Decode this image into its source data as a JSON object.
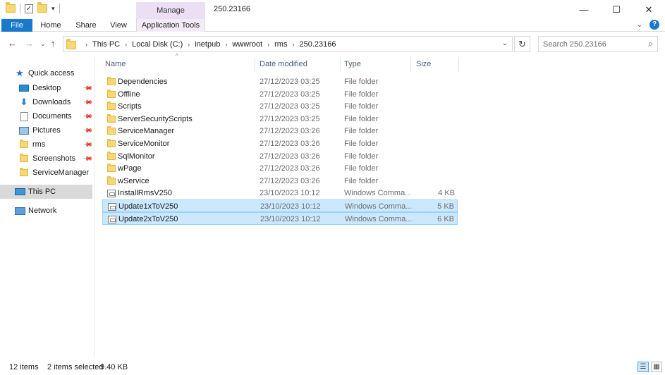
{
  "window": {
    "title": "250.23166",
    "minimize_glyph": "—",
    "maximize_glyph": "☐",
    "close_glyph": "✕"
  },
  "contextual_tab": {
    "label": "Manage",
    "color": "#ecdff3"
  },
  "ribbon": {
    "tabs": [
      {
        "label": "File"
      },
      {
        "label": "Home"
      },
      {
        "label": "Share"
      },
      {
        "label": "View"
      },
      {
        "label": "Application Tools"
      }
    ],
    "file_tab_color": "#1979ca"
  },
  "address": {
    "crumbs": [
      "This PC",
      "Local Disk (C:)",
      "inetpub",
      "wwwroot",
      "rms",
      "250.23166"
    ]
  },
  "search": {
    "placeholder": "Search 250.23166"
  },
  "nav": {
    "quick_access": "Quick access",
    "items": [
      {
        "label": "Desktop",
        "icon": "desktop-icon",
        "pinned": true
      },
      {
        "label": "Downloads",
        "icon": "downloads-icon",
        "pinned": true
      },
      {
        "label": "Documents",
        "icon": "documents-icon",
        "pinned": true
      },
      {
        "label": "Pictures",
        "icon": "pictures-icon",
        "pinned": true
      },
      {
        "label": "rms",
        "icon": "folder-icon",
        "pinned": true
      },
      {
        "label": "Screenshots",
        "icon": "folder-icon",
        "pinned": true
      },
      {
        "label": "ServiceManager",
        "icon": "folder-icon",
        "pinned": false
      }
    ],
    "this_pc": "This PC",
    "network": "Network"
  },
  "columns": {
    "name": "Name",
    "date": "Date modified",
    "type": "Type",
    "size": "Size"
  },
  "files": [
    {
      "name": "Dependencies",
      "date": "27/12/2023 03:25",
      "type": "File folder",
      "size": "",
      "icon": "folder-icon",
      "selected": false
    },
    {
      "name": "Offline",
      "date": "27/12/2023 03:25",
      "type": "File folder",
      "size": "",
      "icon": "folder-icon",
      "selected": false
    },
    {
      "name": "Scripts",
      "date": "27/12/2023 03:25",
      "type": "File folder",
      "size": "",
      "icon": "folder-icon",
      "selected": false
    },
    {
      "name": "ServerSecurityScripts",
      "date": "27/12/2023 03:25",
      "type": "File folder",
      "size": "",
      "icon": "folder-icon",
      "selected": false
    },
    {
      "name": "ServiceManager",
      "date": "27/12/2023 03:26",
      "type": "File folder",
      "size": "",
      "icon": "folder-icon",
      "selected": false
    },
    {
      "name": "ServiceMonitor",
      "date": "27/12/2023 03:26",
      "type": "File folder",
      "size": "",
      "icon": "folder-icon",
      "selected": false
    },
    {
      "name": "SqlMonitor",
      "date": "27/12/2023 03:26",
      "type": "File folder",
      "size": "",
      "icon": "folder-icon",
      "selected": false
    },
    {
      "name": "wPage",
      "date": "27/12/2023 03:26",
      "type": "File folder",
      "size": "",
      "icon": "folder-icon",
      "selected": false
    },
    {
      "name": "wService",
      "date": "27/12/2023 03:26",
      "type": "File folder",
      "size": "",
      "icon": "folder-icon",
      "selected": false
    },
    {
      "name": "InstallRmsV250",
      "date": "23/10/2023 10:12",
      "type": "Windows Comma...",
      "size": "4 KB",
      "icon": "cmd-file-icon",
      "selected": false
    },
    {
      "name": "Update1xToV250",
      "date": "23/10/2023 10:12",
      "type": "Windows Comma...",
      "size": "5 KB",
      "icon": "cmd-file-icon",
      "selected": true
    },
    {
      "name": "Update2xToV250",
      "date": "23/10/2023 10:12",
      "type": "Windows Comma...",
      "size": "6 KB",
      "icon": "cmd-file-icon",
      "selected": true
    }
  ],
  "status": {
    "count": "12 items",
    "selected": "2 items selected",
    "size": "9.40 KB"
  },
  "colors": {
    "selection_bg": "#cce8ff",
    "selection_border": "#99d1ff",
    "accent": "#1979ca"
  }
}
